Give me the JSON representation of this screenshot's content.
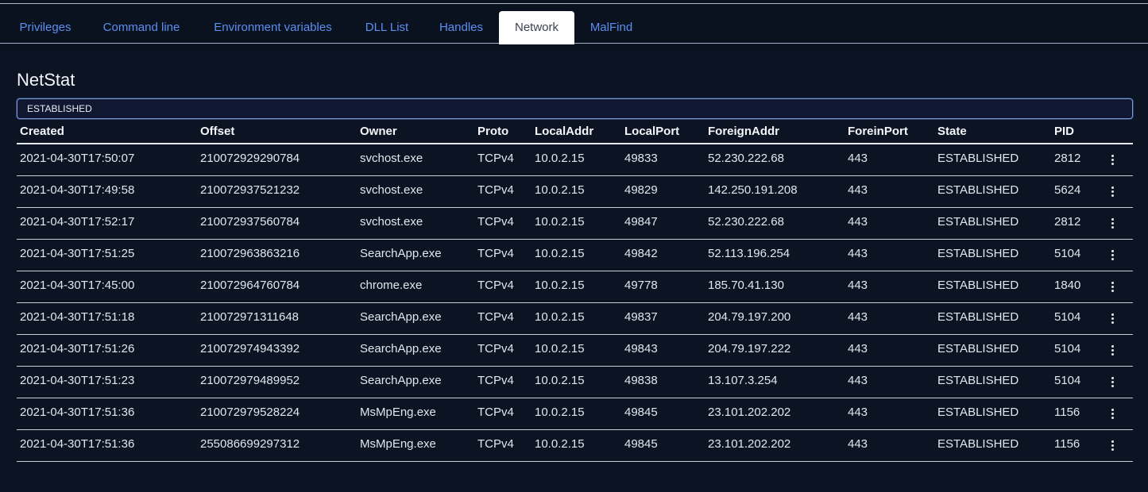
{
  "tabs": [
    {
      "label": "Privileges",
      "active": false
    },
    {
      "label": "Command line",
      "active": false
    },
    {
      "label": "Environment variables",
      "active": false
    },
    {
      "label": "DLL List",
      "active": false
    },
    {
      "label": "Handles",
      "active": false
    },
    {
      "label": "Network",
      "active": true
    },
    {
      "label": "MalFind",
      "active": false
    }
  ],
  "section_title": "NetStat",
  "filter": {
    "value": "ESTABLISHED"
  },
  "table": {
    "headers": [
      "Created",
      "Offset",
      "Owner",
      "Proto",
      "LocalAddr",
      "LocalPort",
      "ForeignAddr",
      "ForeinPort",
      "State",
      "PID"
    ],
    "rows": [
      [
        "2021-04-30T17:50:07",
        "210072929290784",
        "svchost.exe",
        "TCPv4",
        "10.0.2.15",
        "49833",
        "52.230.222.68",
        "443",
        "ESTABLISHED",
        "2812"
      ],
      [
        "2021-04-30T17:49:58",
        "210072937521232",
        "svchost.exe",
        "TCPv4",
        "10.0.2.15",
        "49829",
        "142.250.191.208",
        "443",
        "ESTABLISHED",
        "5624"
      ],
      [
        "2021-04-30T17:52:17",
        "210072937560784",
        "svchost.exe",
        "TCPv4",
        "10.0.2.15",
        "49847",
        "52.230.222.68",
        "443",
        "ESTABLISHED",
        "2812"
      ],
      [
        "2021-04-30T17:51:25",
        "210072963863216",
        "SearchApp.exe",
        "TCPv4",
        "10.0.2.15",
        "49842",
        "52.113.196.254",
        "443",
        "ESTABLISHED",
        "5104"
      ],
      [
        "2021-04-30T17:45:00",
        "210072964760784",
        "chrome.exe",
        "TCPv4",
        "10.0.2.15",
        "49778",
        "185.70.41.130",
        "443",
        "ESTABLISHED",
        "1840"
      ],
      [
        "2021-04-30T17:51:18",
        "210072971311648",
        "SearchApp.exe",
        "TCPv4",
        "10.0.2.15",
        "49837",
        "204.79.197.200",
        "443",
        "ESTABLISHED",
        "5104"
      ],
      [
        "2021-04-30T17:51:26",
        "210072974943392",
        "SearchApp.exe",
        "TCPv4",
        "10.0.2.15",
        "49843",
        "204.79.197.222",
        "443",
        "ESTABLISHED",
        "5104"
      ],
      [
        "2021-04-30T17:51:23",
        "210072979489952",
        "SearchApp.exe",
        "TCPv4",
        "10.0.2.15",
        "49838",
        "13.107.3.254",
        "443",
        "ESTABLISHED",
        "5104"
      ],
      [
        "2021-04-30T17:51:36",
        "210072979528224",
        "MsMpEng.exe",
        "TCPv4",
        "10.0.2.15",
        "49845",
        "23.101.202.202",
        "443",
        "ESTABLISHED",
        "1156"
      ],
      [
        "2021-04-30T17:51:36",
        "255086699297312",
        "MsMpEng.exe",
        "TCPv4",
        "10.0.2.15",
        "49845",
        "23.101.202.202",
        "443",
        "ESTABLISHED",
        "1156"
      ]
    ]
  },
  "icons": {
    "row_menu": "more-vertical-icon"
  },
  "colors": {
    "background": "#0a111f",
    "tab_link": "#5b8ff0",
    "active_tab_bg": "#ffffff"
  }
}
